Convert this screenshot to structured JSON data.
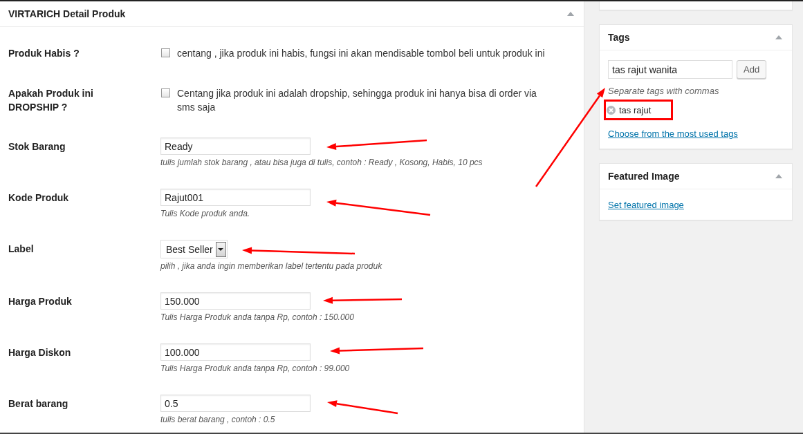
{
  "main_panel": {
    "title": "VIRTARICH Detail Produk",
    "expanded": true,
    "fields": [
      {
        "kind": "checkbox",
        "label": "Produk Habis ?",
        "checked": false,
        "description": "centang , jika produk ini habis, fungsi ini akan mendisable tombol beli untuk produk ini"
      },
      {
        "kind": "checkbox",
        "label": "Apakah Produk ini DROPSHIP ?",
        "checked": false,
        "description": "Centang jika produk ini adalah dropship, sehingga produk ini hanya bisa di order via sms saja"
      },
      {
        "kind": "text",
        "label": "Stok Barang",
        "value": "Ready",
        "help": "tulis jumlah stok barang , atau bisa juga di tulis, contoh : Ready , Kosong, Habis, 10 pcs"
      },
      {
        "kind": "text",
        "label": "Kode Produk",
        "value": "Rajut001",
        "help": "Tulis Kode produk anda."
      },
      {
        "kind": "select",
        "label": "Label",
        "value": "Best Seller",
        "help": "pilih , jika anda ingin memberikan label tertentu pada produk"
      },
      {
        "kind": "text",
        "label": "Harga Produk",
        "value": "150.000",
        "help": "Tulis Harga Produk anda tanpa Rp, contoh : 150.000"
      },
      {
        "kind": "text",
        "label": "Harga Diskon",
        "value": "100.000",
        "help": "Tulis Harga Produk anda tanpa Rp, contoh : 99.000"
      },
      {
        "kind": "text",
        "label": "Berat barang",
        "value": "0.5",
        "help": "tulis berat barang , contoh : 0.5"
      }
    ]
  },
  "sidebar": {
    "tags_box": {
      "title": "Tags",
      "expanded": true,
      "input_value": "tas rajut wanita",
      "add_button": "Add",
      "hint": "Separate tags with commas",
      "tags": [
        {
          "label": "tas rajut",
          "highlighted": true
        }
      ],
      "link": "Choose from the most used tags"
    },
    "featured_image_box": {
      "title": "Featured Image",
      "expanded": true,
      "link": "Set featured image"
    }
  }
}
